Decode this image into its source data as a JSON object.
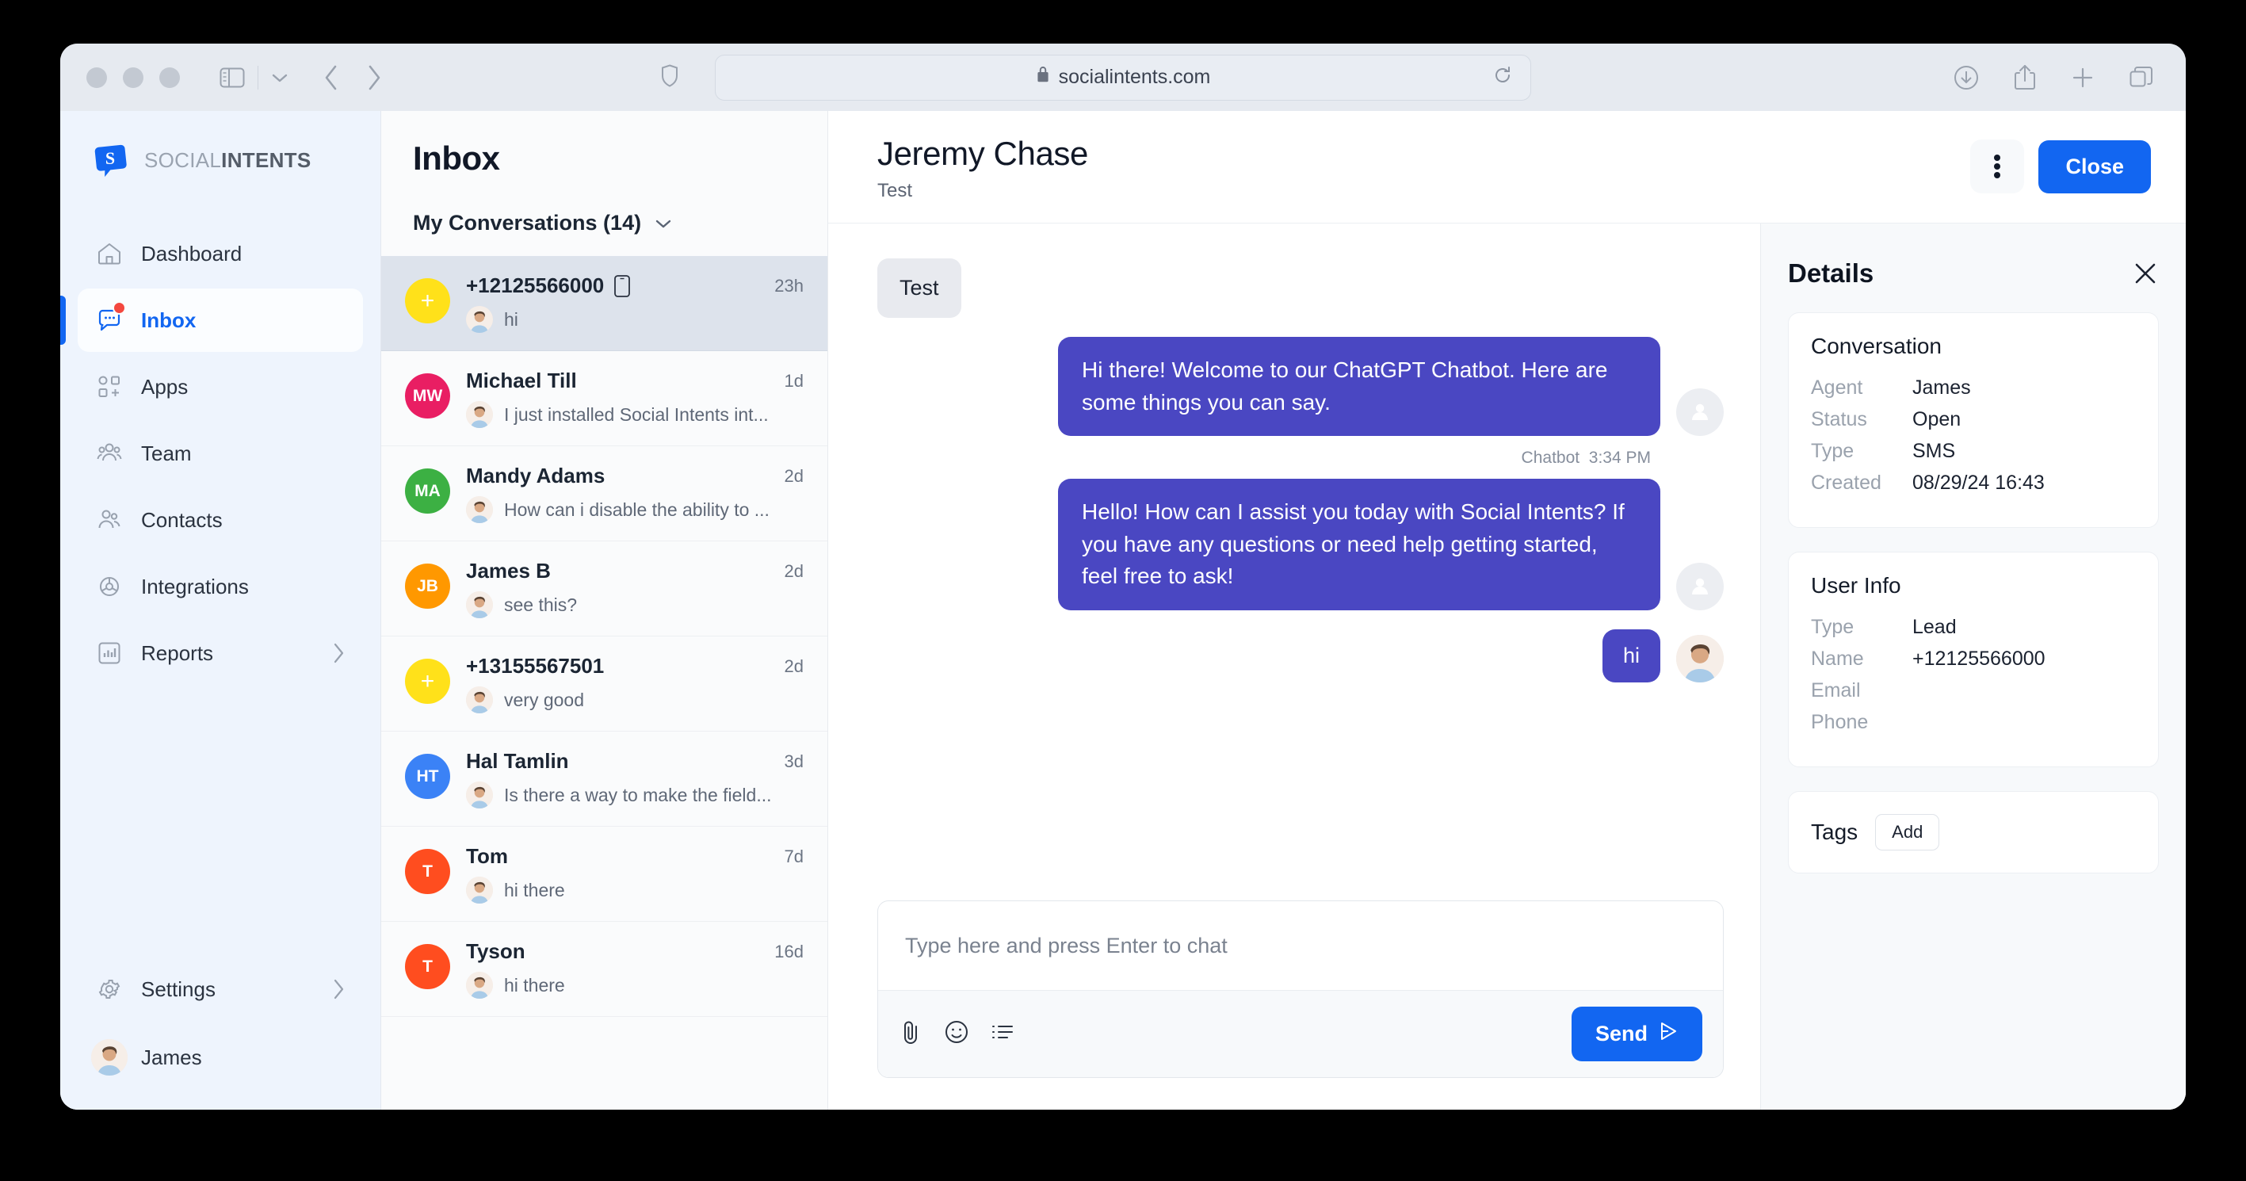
{
  "browser": {
    "url": "socialintents.com",
    "lock_icon": "lock-icon",
    "reload_icon": "reload-icon",
    "shield_icon": "shield-icon",
    "sidebar_icon": "sidebar-toggle-icon",
    "back_icon": "back-chevron-icon",
    "forward_icon": "forward-chevron-icon",
    "download_icon": "download-icon",
    "share_icon": "share-icon",
    "newtab_icon": "plus-icon",
    "tabs_icon": "tab-overview-icon"
  },
  "brand": {
    "light": "SOCIAL",
    "bold": "INTENTS"
  },
  "sidebar": {
    "items": [
      {
        "label": "Dashboard",
        "icon": "home-icon",
        "active": false,
        "badge": false,
        "chevron": false
      },
      {
        "label": "Inbox",
        "icon": "chat-bubble-icon",
        "active": true,
        "badge": true,
        "chevron": false
      },
      {
        "label": "Apps",
        "icon": "apps-grid-plus-icon",
        "active": false,
        "badge": false,
        "chevron": false
      },
      {
        "label": "Team",
        "icon": "team-group-icon",
        "active": false,
        "badge": false,
        "chevron": false
      },
      {
        "label": "Contacts",
        "icon": "contacts-people-icon",
        "active": false,
        "badge": false,
        "chevron": false
      },
      {
        "label": "Integrations",
        "icon": "gear-cog-icon",
        "active": false,
        "badge": false,
        "chevron": false
      },
      {
        "label": "Reports",
        "icon": "bar-chart-icon",
        "active": false,
        "badge": false,
        "chevron": true
      }
    ],
    "bottom": [
      {
        "label": "Settings",
        "icon": "gear-icon",
        "chevron": true
      }
    ],
    "user": {
      "name": "James",
      "avatar": "user-photo-avatar"
    }
  },
  "inbox": {
    "title": "Inbox",
    "filter_label": "My Conversations (14)",
    "filter_chevron": "chevron-down-icon",
    "conversations": [
      {
        "name": "+12125566000",
        "preview": "hi",
        "time": "23h",
        "initials": "+",
        "color": "#ffe11a",
        "selected": true,
        "phone_icon": true
      },
      {
        "name": "Michael Till",
        "preview": "I just installed Social Intents int...",
        "time": "1d",
        "initials": "MW",
        "color": "#e91e63",
        "selected": false,
        "phone_icon": false
      },
      {
        "name": "Mandy Adams",
        "preview": "How can i disable the ability to ...",
        "time": "2d",
        "initials": "MA",
        "color": "#3cb043",
        "selected": false,
        "phone_icon": false
      },
      {
        "name": "James B",
        "preview": "see this?",
        "time": "2d",
        "initials": "JB",
        "color": "#ff9800",
        "selected": false,
        "phone_icon": false
      },
      {
        "name": "+13155567501",
        "preview": "very good",
        "time": "2d",
        "initials": "+",
        "color": "#ffe11a",
        "selected": false,
        "phone_icon": false
      },
      {
        "name": "Hal Tamlin",
        "preview": "Is there a way to make the field...",
        "time": "3d",
        "initials": "HT",
        "color": "#3b82f6",
        "selected": false,
        "phone_icon": false
      },
      {
        "name": "Tom",
        "preview": "hi there",
        "time": "7d",
        "initials": "T",
        "color": "#ff4d1f",
        "selected": false,
        "phone_icon": false
      },
      {
        "name": "Tyson",
        "preview": "hi there",
        "time": "16d",
        "initials": "T",
        "color": "#ff4d1f",
        "selected": false,
        "phone_icon": false
      }
    ]
  },
  "chat": {
    "title": "Jeremy Chase",
    "subtitle": "Test",
    "kebab_icon": "more-vertical-icon",
    "close_label": "Close",
    "messages": [
      {
        "from": "visitor",
        "text": "Test"
      },
      {
        "from": "agent",
        "text": "Hi there! Welcome to our ChatGPT Chatbot. Here are some things you can say."
      },
      {
        "from": "agent",
        "text": "Hello! How can I assist you today with Social Intents? If you have any questions or need help getting started, feel free to ask!"
      },
      {
        "from": "user",
        "text": "hi"
      }
    ],
    "meta_sender": "Chatbot",
    "meta_time": "3:34 PM",
    "composer_placeholder": "Type here and press Enter to chat",
    "attach_icon": "paperclip-icon",
    "emoji_icon": "smiley-face-icon",
    "canned_icon": "list-lines-icon",
    "send_label": "Send",
    "send_icon": "send-triangle-icon"
  },
  "details": {
    "title": "Details",
    "close_icon": "close-x-icon",
    "conversation": {
      "title": "Conversation",
      "rows": [
        {
          "key": "Agent",
          "value": "James"
        },
        {
          "key": "Status",
          "value": "Open"
        },
        {
          "key": "Type",
          "value": "SMS"
        },
        {
          "key": "Created",
          "value": "08/29/24 16:43"
        }
      ]
    },
    "user_info": {
      "title": "User Info",
      "rows": [
        {
          "key": "Type",
          "value": "Lead"
        },
        {
          "key": "Name",
          "value": "+12125566000"
        },
        {
          "key": "Email",
          "value": ""
        },
        {
          "key": "Phone",
          "value": ""
        }
      ]
    },
    "tags": {
      "label": "Tags",
      "add_label": "Add"
    }
  },
  "colors": {
    "accent_blue": "#1266f1",
    "bubble_purple": "#4a47c2",
    "sidebar_bg": "#eef4fd",
    "selected_row": "#dde3ec"
  }
}
